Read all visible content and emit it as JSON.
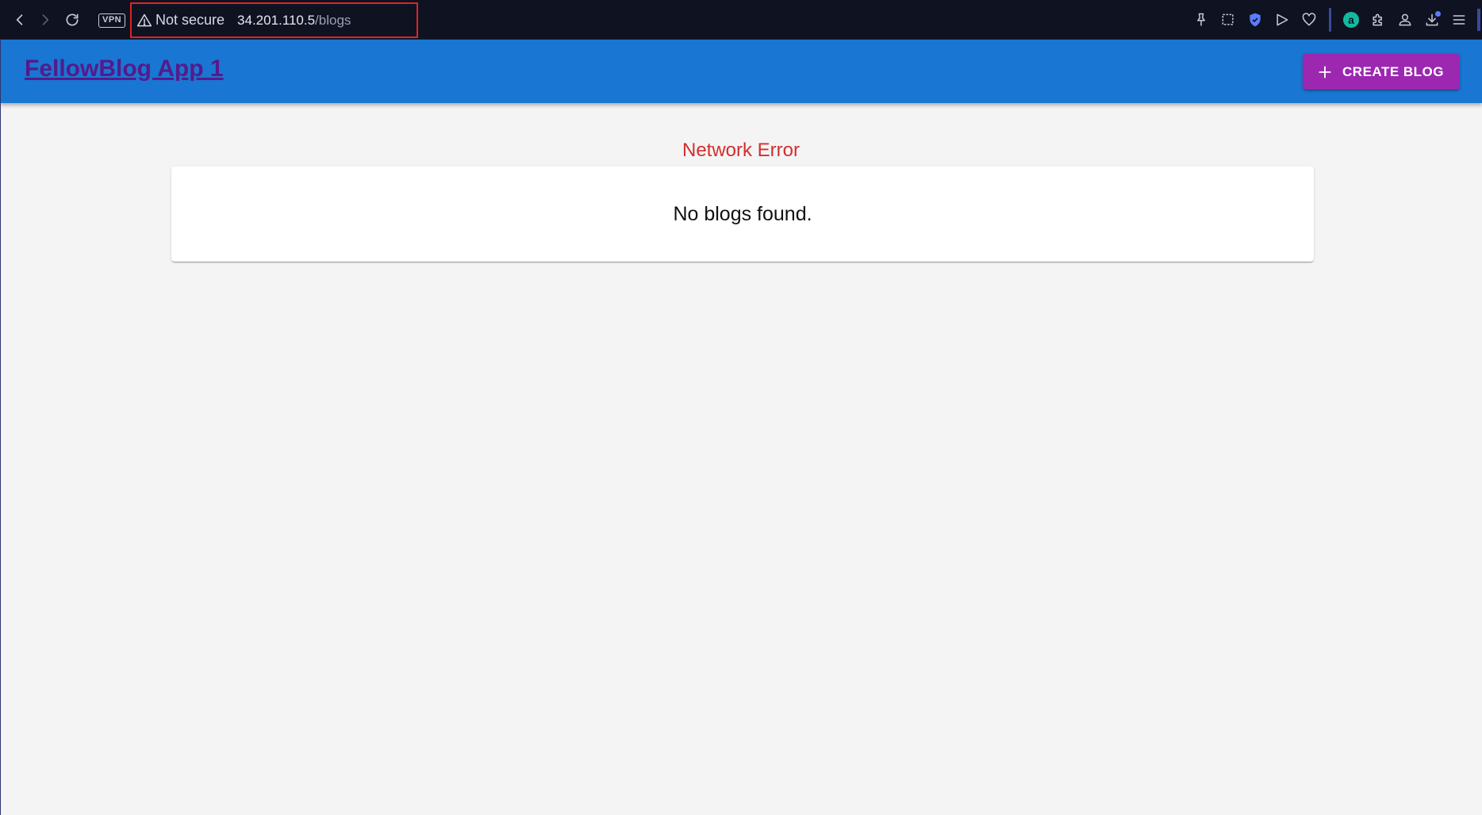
{
  "browser": {
    "vpn_label": "VPN",
    "security_label": "Not secure",
    "url_host": "34.201.110.5",
    "url_path": "/blogs",
    "extension_letter": "a"
  },
  "app_bar": {
    "title": "FellowBlog App 1",
    "create_button_label": "CREATE BLOG"
  },
  "main": {
    "error_message": "Network Error",
    "empty_message": "No blogs found."
  },
  "colors": {
    "app_bar": "#1976d2",
    "create_button": "#9c27b0",
    "error": "#d32f2f",
    "title_link": "#551a8b"
  }
}
